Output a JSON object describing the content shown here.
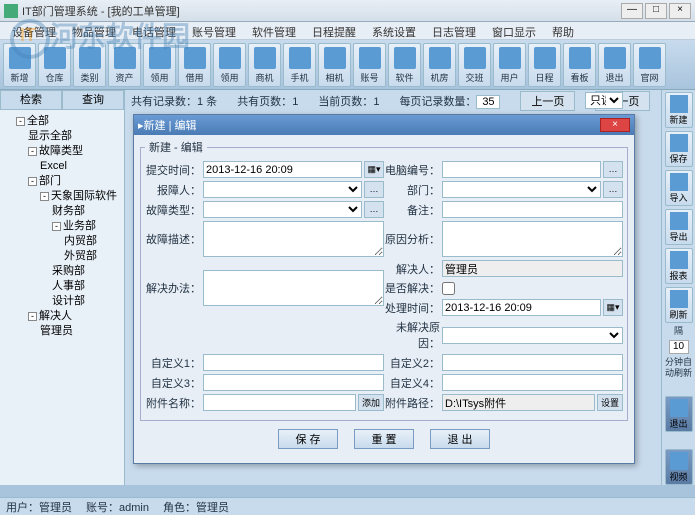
{
  "window": {
    "title": "IT部门管理系统 - [我的工单管理]"
  },
  "watermark": "河东软件园",
  "menu": [
    "设备管理",
    "物品管理",
    "电话管理",
    "账号管理",
    "软件管理",
    "日程提醒",
    "系统设置",
    "日志管理",
    "窗口显示",
    "帮助"
  ],
  "toolbar": [
    "新增",
    "仓库",
    "类别",
    "资产",
    "领用",
    "借用",
    "领用",
    "商机",
    "手机",
    "相机",
    "账号",
    "软件",
    "机房",
    "交班",
    "用户",
    "日程",
    "看板",
    "退出",
    "官网"
  ],
  "tabs": {
    "t1": "检索",
    "t2": "查询"
  },
  "tree": {
    "root": "全部",
    "showall": "显示全部",
    "fault": "故障类型",
    "excel": "Excel",
    "dept": "部门",
    "c1": "天象国际软件",
    "d1": "财务部",
    "d2": "业务部",
    "d2a": "内贸部",
    "d2b": "外贸部",
    "d3": "采购部",
    "d4": "人事部",
    "d5": "设计部",
    "solver": "解决人",
    "admin": "管理员"
  },
  "pager": {
    "total_label": "共有记录数：",
    "total": "1 条",
    "pages_label": "共有页数：",
    "pages": "1",
    "cur_label": "当前页数：",
    "cur": "1",
    "perpage_label": "每页记录数量：",
    "perpage": "35",
    "prev": "上一页",
    "next": "下一页",
    "readonly": "只读"
  },
  "rightbar": {
    "new": "新建",
    "save": "保存",
    "import": "导入",
    "export": "导出",
    "report": "报表",
    "refresh": "刷新",
    "interval_l1": "隔",
    "interval_v": "10",
    "interval_l2": "分钟自动刷新",
    "exit": "退出",
    "video": "视频"
  },
  "dialog": {
    "title": "新建 | 编辑",
    "legend": "新建 - 编辑",
    "l_time": "提交时间：",
    "v_time": "2013-12-16 20:09",
    "l_pcno": "电脑编号：",
    "l_reporter": "报障人：",
    "l_dept": "部门：",
    "l_ftype": "故障类型：",
    "l_remark": "备注：",
    "l_fdesc": "故障描述：",
    "l_cause": "原因分析：",
    "l_solution": "解决办法：",
    "l_solver": "解决人：",
    "v_solver": "管理员",
    "l_solved": "是否解决：",
    "l_ptime": "处理时间：",
    "v_ptime": "2013-12-16 20:09",
    "l_unsolved": "未解决原因：",
    "l_c1": "自定义1：",
    "l_c2": "自定义2：",
    "l_c3": "自定义3：",
    "l_c4": "自定义4：",
    "l_attname": "附件名称：",
    "l_attpath": "附件路径：",
    "v_attpath": "D:\\ITsys附件",
    "b_add": "添加",
    "b_set": "设置",
    "b_save": "保 存",
    "b_reset": "重 置",
    "b_exit": "退 出"
  },
  "status": {
    "user_l": "用户：",
    "user": "管理员",
    "acct_l": "账号：",
    "acct": "admin",
    "role_l": "角色：",
    "role": "管理员"
  }
}
